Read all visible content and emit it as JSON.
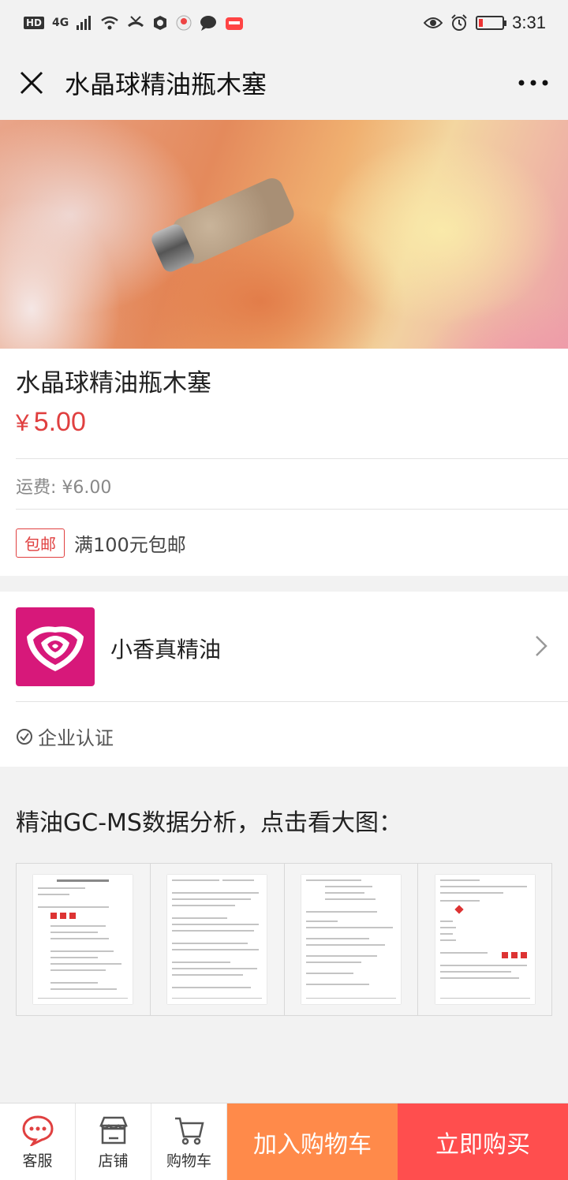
{
  "status_bar": {
    "network": "4G",
    "time": "3:31"
  },
  "nav": {
    "title": "水晶球精油瓶木塞",
    "more_label": "•••"
  },
  "product": {
    "title": "水晶球精油瓶木塞",
    "currency": "¥",
    "price": "5.00",
    "shipping": "运费: ¥6.00",
    "promo_badge": "包邮",
    "promo_text": "满100元包邮"
  },
  "shop": {
    "name": "小香真精油",
    "certification": "企业认证"
  },
  "gcms": {
    "title": "精油GC-MS数据分析，点击看大图："
  },
  "bottom_bar": {
    "tabs": [
      {
        "label": "客服",
        "icon": "chat-icon"
      },
      {
        "label": "店铺",
        "icon": "store-icon"
      },
      {
        "label": "购物车",
        "icon": "cart-icon"
      }
    ],
    "add_to_cart": "加入购物车",
    "buy_now": "立即购买"
  },
  "colors": {
    "price_red": "#e04040",
    "cart_orange": "#ff8a4a",
    "buy_red": "#ff4e4e",
    "shop_logo": "#d7187a"
  }
}
